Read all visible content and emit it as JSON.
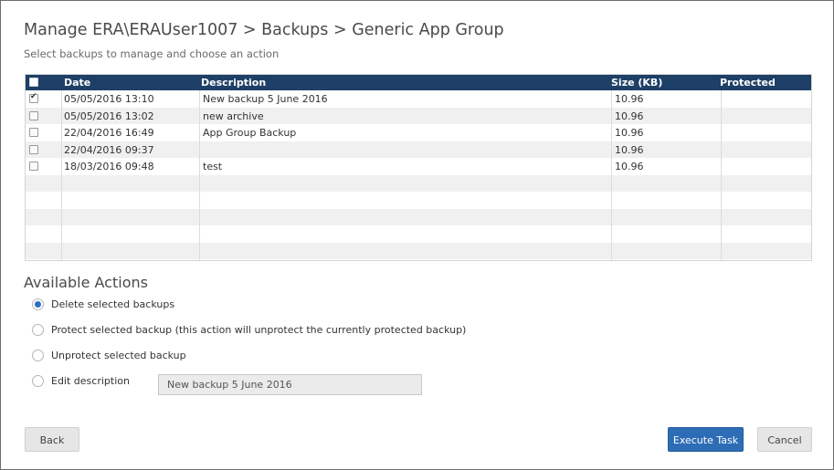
{
  "header": {
    "title": "Manage ERA\\ERAUser1007 > Backups > Generic App Group",
    "subtitle": "Select backups to manage and choose an action"
  },
  "table": {
    "columns": [
      "Date",
      "Description",
      "Size (KB)",
      "Protected"
    ],
    "rows": [
      {
        "checked": true,
        "date": "05/05/2016 13:10",
        "description": "New backup 5 June 2016",
        "size": "10.96",
        "protected": ""
      },
      {
        "checked": false,
        "date": "05/05/2016 13:02",
        "description": "new archive",
        "size": "10.96",
        "protected": ""
      },
      {
        "checked": false,
        "date": "22/04/2016 16:49",
        "description": "App Group Backup",
        "size": "10.96",
        "protected": ""
      },
      {
        "checked": false,
        "date": "22/04/2016 09:37",
        "description": "",
        "size": "10.96",
        "protected": ""
      },
      {
        "checked": false,
        "date": "18/03/2016 09:48",
        "description": "test",
        "size": "10.96",
        "protected": ""
      }
    ]
  },
  "actions": {
    "title": "Available Actions",
    "options": [
      {
        "label": "Delete selected backups",
        "selected": true
      },
      {
        "label": "Protect selected backup (this action will unprotect the currently protected backup)",
        "selected": false
      },
      {
        "label": "Unprotect selected backup",
        "selected": false
      },
      {
        "label": "Edit description",
        "selected": false
      }
    ],
    "description_value": "New backup 5 June 2016"
  },
  "buttons": {
    "back": "Back",
    "execute": "Execute Task",
    "cancel": "Cancel"
  },
  "colors": {
    "header_bg": "#1e3f66",
    "primary": "#2d6db5",
    "radio_selected": "#2b6fc2"
  }
}
